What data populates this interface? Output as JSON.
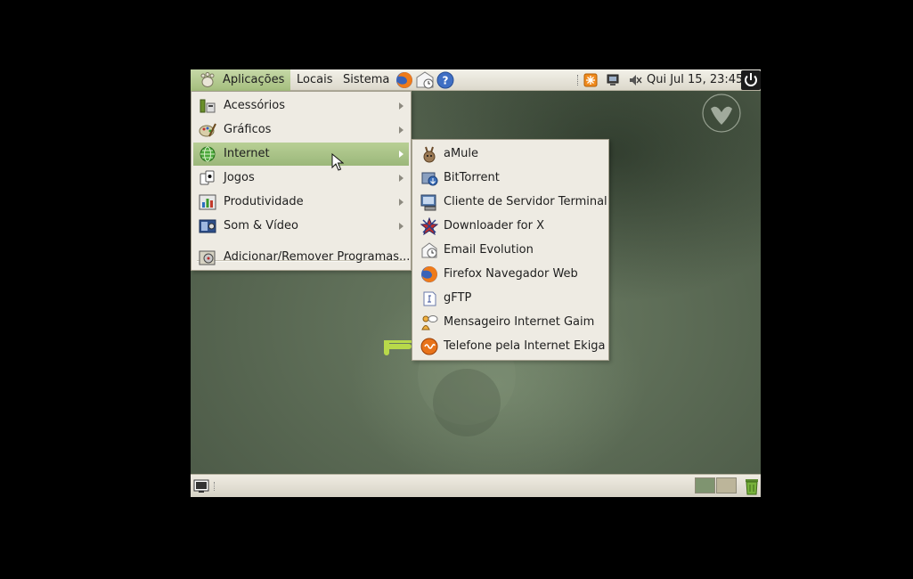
{
  "top_panel": {
    "menus": {
      "applications": "Aplicações",
      "places": "Locais",
      "system": "Sistema"
    },
    "launchers": {
      "firefox": "firefox-icon",
      "mail": "mail-icon",
      "help": "help-icon"
    },
    "clock": "Qui Jul 15, 23:45"
  },
  "applications_menu": {
    "items": [
      {
        "label": "Acessórios",
        "icon": "accessories-icon",
        "submenu": true
      },
      {
        "label": "Gráficos",
        "icon": "graphics-icon",
        "submenu": true
      },
      {
        "label": "Internet",
        "icon": "internet-icon",
        "submenu": true,
        "selected": true
      },
      {
        "label": "Jogos",
        "icon": "games-icon",
        "submenu": true
      },
      {
        "label": "Produtividade",
        "icon": "productivity-icon",
        "submenu": true
      },
      {
        "label": "Som & Vídeo",
        "icon": "sound-video-icon",
        "submenu": true
      }
    ],
    "add_remove": {
      "label": "Adicionar/Remover Programas...",
      "icon": "add-remove-icon"
    }
  },
  "internet_submenu": {
    "items": [
      {
        "label": "aMule",
        "icon": "amule-icon"
      },
      {
        "label": "BitTorrent",
        "icon": "bittorrent-icon"
      },
      {
        "label": "Cliente de Servidor Terminal",
        "icon": "terminal-server-icon"
      },
      {
        "label": "Downloader for X",
        "icon": "downloader-icon"
      },
      {
        "label": "Email Evolution",
        "icon": "evolution-icon"
      },
      {
        "label": "Firefox Navegador Web",
        "icon": "firefox-icon"
      },
      {
        "label": "gFTP",
        "icon": "gftp-icon"
      },
      {
        "label": "Mensageiro Internet Gaim",
        "icon": "gaim-icon"
      },
      {
        "label": "Telefone pela Internet Ekiga",
        "icon": "ekiga-icon"
      }
    ]
  },
  "colors": {
    "panel": "#dcd8cb",
    "menu_bg": "#eeebe3",
    "selection": "#a4be7d",
    "desktop": "#5f6f58"
  }
}
